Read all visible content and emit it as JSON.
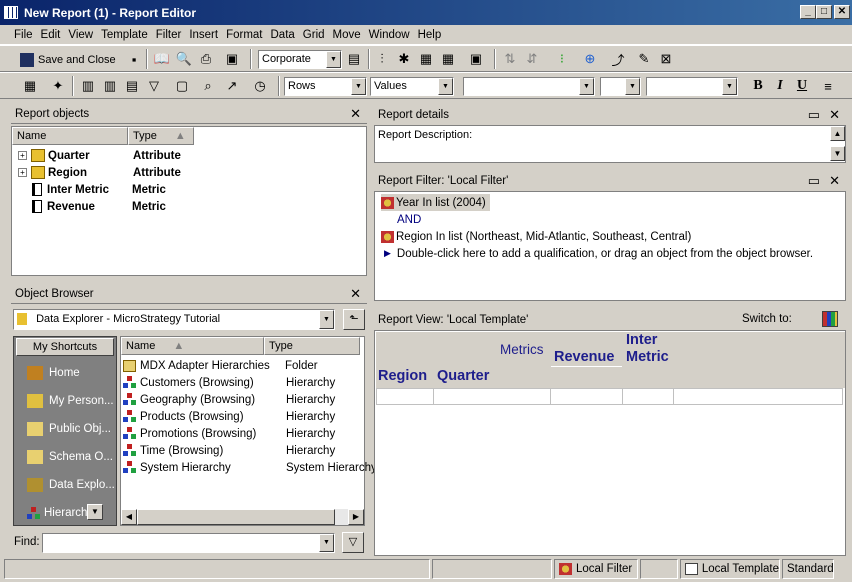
{
  "window": {
    "title": "New Report (1) - Report Editor"
  },
  "menu": [
    "File",
    "Edit",
    "View",
    "Template",
    "Filter",
    "Insert",
    "Format",
    "Data",
    "Grid",
    "Move",
    "Window",
    "Help"
  ],
  "toolbar1": {
    "save_close_label": "Save and Close",
    "style_combo": "Corporate"
  },
  "toolbar2": {
    "rows_combo": "Rows",
    "values_combo": "Values",
    "bold": "B",
    "italic": "I",
    "underline": "U"
  },
  "report_objects": {
    "title": "Report objects",
    "columns": [
      "Name",
      "Type"
    ],
    "items": [
      {
        "name": "Quarter",
        "type": "Attribute",
        "icon": "attribute-icon"
      },
      {
        "name": "Region",
        "type": "Attribute",
        "icon": "attribute-icon"
      },
      {
        "name": "Inter Metric",
        "type": "Metric",
        "icon": "metric-icon"
      },
      {
        "name": "Revenue",
        "type": "Metric",
        "icon": "metric-icon"
      }
    ]
  },
  "object_browser": {
    "title": "Object Browser",
    "location": "Data Explorer - MicroStrategy Tutorial",
    "shortcuts_label": "My Shortcuts",
    "shortcuts": [
      "Home",
      "My Person...",
      "Public Obj...",
      "Schema O...",
      "Data Explo...",
      "Hierarchi..."
    ],
    "columns": [
      "Name",
      "Type"
    ],
    "items": [
      {
        "name": "MDX Adapter Hierarchies",
        "type": "Folder"
      },
      {
        "name": "Customers (Browsing)",
        "type": "Hierarchy"
      },
      {
        "name": "Geography (Browsing)",
        "type": "Hierarchy"
      },
      {
        "name": "Products (Browsing)",
        "type": "Hierarchy"
      },
      {
        "name": "Promotions (Browsing)",
        "type": "Hierarchy"
      },
      {
        "name": "Time (Browsing)",
        "type": "Hierarchy"
      },
      {
        "name": "System Hierarchy",
        "type": "System Hierarchy"
      }
    ],
    "find_label": "Find:"
  },
  "report_details": {
    "title": "Report details",
    "description_label": "Report Description:"
  },
  "report_filter": {
    "title": "Report Filter: 'Local Filter'",
    "line1": "Year In list (2004)",
    "operator": "AND",
    "line2": "Region In list (Northeast, Mid-Atlantic, Southeast, Central)",
    "hint": "Double-click here to add a qualification, or drag an object from the object browser."
  },
  "report_view": {
    "title": "Report View: 'Local Template'",
    "switch_label": "Switch to:",
    "metrics_label": "Metrics",
    "row_headers": [
      "Region",
      "Quarter"
    ],
    "metric_headers": [
      "Revenue",
      "Inter Metric"
    ]
  },
  "statusbar": {
    "filter": "Local Filter",
    "template": "Local Template",
    "mode": "Standard"
  }
}
